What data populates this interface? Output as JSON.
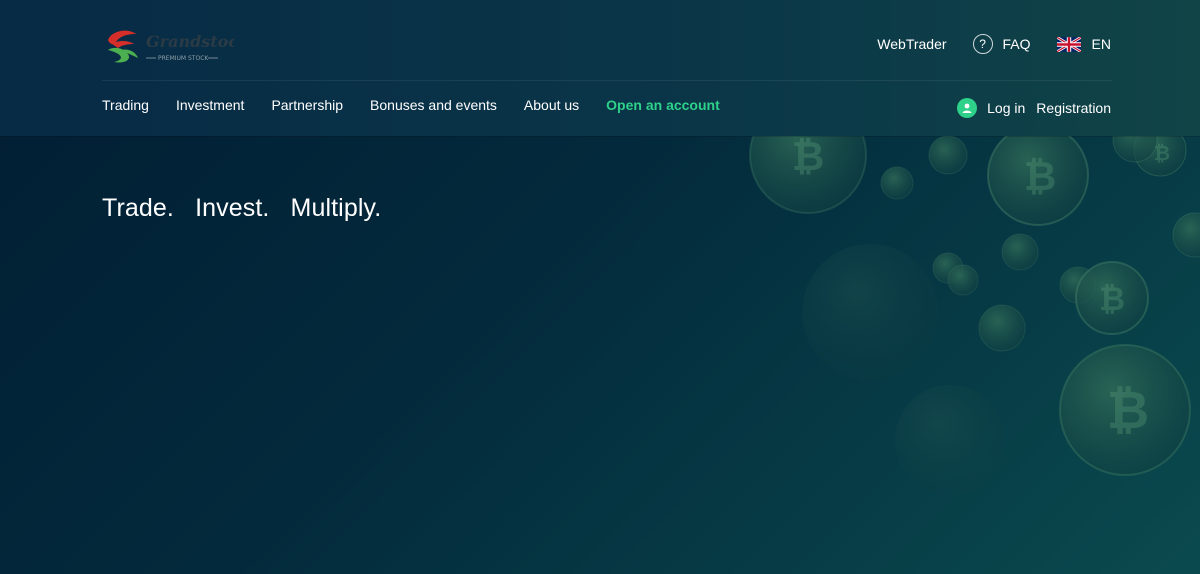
{
  "brand": {
    "logo_name": "Grandstock",
    "logo_tagline": "PREMIUM STOCK",
    "logo_colors": {
      "red": "#d62f2a",
      "green": "#4caf50"
    }
  },
  "top_bar": {
    "webtrader_label": "WebTrader",
    "faq_label": "FAQ",
    "faq_icon_glyph": "?",
    "language_label": "EN",
    "language_icon": "uk-flag-icon"
  },
  "nav": {
    "items": [
      {
        "label": "Trading"
      },
      {
        "label": "Investment"
      },
      {
        "label": "Partnership"
      },
      {
        "label": "Bonuses and events"
      },
      {
        "label": "About us"
      },
      {
        "label": "Open an account"
      }
    ]
  },
  "auth": {
    "login_label": "Log in",
    "registration_label": "Registration",
    "user_icon": "user-icon"
  },
  "hero": {
    "title": "Trade.   Invest.   Multiply."
  },
  "colors": {
    "accent": "#2ed18a",
    "header_bg": "#0a3548",
    "page_bg": "#032a3c",
    "text": "#ffffff"
  }
}
